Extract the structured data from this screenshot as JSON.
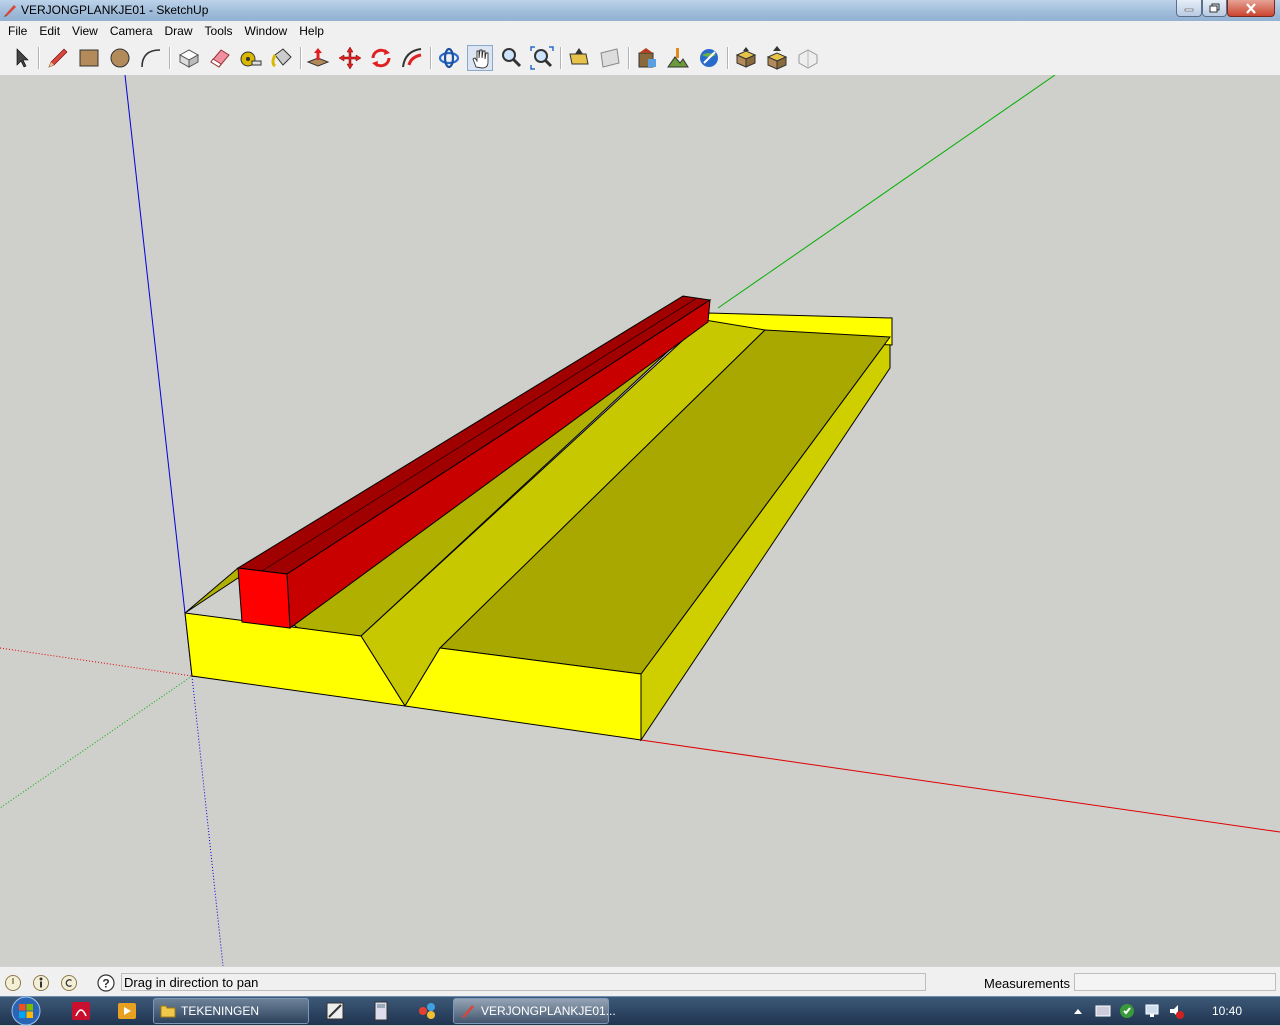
{
  "window": {
    "title": "VERJONGPLANKJE01 - SketchUp"
  },
  "menu": {
    "items": [
      "File",
      "Edit",
      "View",
      "Camera",
      "Draw",
      "Tools",
      "Window",
      "Help"
    ]
  },
  "toolbar": {
    "tools": [
      "select-icon",
      "pencil-icon",
      "rectangle-icon",
      "circle-icon",
      "arc-icon",
      "make-component-icon",
      "eraser-icon",
      "tape-measure-icon",
      "paint-bucket-icon",
      "push-pull-icon",
      "move-icon",
      "rotate-icon",
      "follow-me-icon",
      "orbit-icon",
      "pan-icon",
      "zoom-icon",
      "zoom-extents-icon",
      "add-location-icon",
      "toggle-terrain-icon",
      "get-models-icon",
      "share-model-icon",
      "google-earth-icon",
      "get-models-icon-2",
      "share-component-icon",
      "warehouse-icon"
    ],
    "active_tool": "pan-icon"
  },
  "model": {
    "colors": {
      "yellow_face": "#ffff00",
      "olive_top": "#a8a800",
      "olive_groove": "#c4c400",
      "olive_side": "#cfcf00",
      "red_front": "#ff0000",
      "red_top": "#a00000",
      "red_side": "#c80000",
      "background": "#cfcfcb",
      "axis_red": "#e00000",
      "axis_green": "#00b000",
      "axis_blue": "#0000e0"
    }
  },
  "statusbar": {
    "hint": "Drag in direction to pan",
    "measurements_label": "Measurements",
    "measurements_value": ""
  },
  "taskbar": {
    "buttons": [
      {
        "label": "TEKENINGEN"
      },
      {
        "label": "VERJONGPLANKJE01..."
      }
    ],
    "clock": "10:40"
  }
}
